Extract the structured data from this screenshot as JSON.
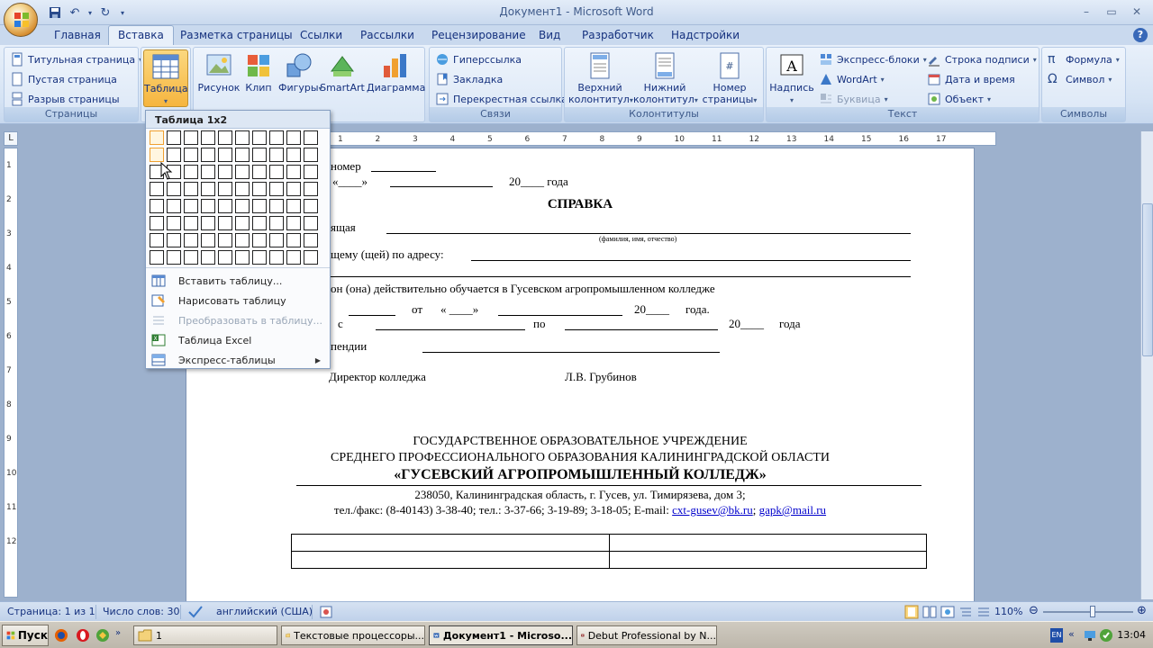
{
  "app": {
    "title": "Документ1 - Microsoft Word",
    "win_controls": [
      "–",
      "▭",
      "✕"
    ]
  },
  "tabs": [
    "Главная",
    "Вставка",
    "Разметка страницы",
    "Ссылки",
    "Рассылки",
    "Рецензирование",
    "Вид",
    "Разработчик",
    "Надстройки"
  ],
  "active_tab": "Вставка",
  "ribbon": {
    "pages": {
      "label": "Страницы",
      "items": [
        "Титульная страница",
        "Пустая страница",
        "Разрыв страницы"
      ]
    },
    "tables": {
      "label": "Таблица"
    },
    "illustrations": {
      "items": [
        "Рисунок",
        "Клип",
        "Фигуры",
        "SmartArt",
        "Диаграмма"
      ]
    },
    "links": {
      "label": "Связи",
      "items": [
        "Гиперссылка",
        "Закладка",
        "Перекрестная ссылка"
      ]
    },
    "header_footer": {
      "label": "Колонтитулы",
      "items": [
        {
          "line1": "Верхний",
          "line2": "колонтитул"
        },
        {
          "line1": "Нижний",
          "line2": "колонтитул"
        },
        {
          "line1": "Номер",
          "line2": "страницы"
        }
      ]
    },
    "text": {
      "label": "Текст",
      "big": "Надпись",
      "items": [
        "Экспресс-блоки",
        "WordArt",
        "Буквица"
      ],
      "items2": [
        "Строка подписи",
        "Дата и время",
        "Объект"
      ]
    },
    "symbols": {
      "label": "Символы",
      "items": [
        "Формула",
        "Символ"
      ]
    }
  },
  "table_menu": {
    "header": "Таблица 1x2",
    "grid_cols": 10,
    "grid_rows": 8,
    "selected_cols": 1,
    "selected_rows": 2,
    "items": [
      {
        "label": "Вставить таблицу...",
        "icon": "insert-table-icon",
        "disabled": false
      },
      {
        "label": "Нарисовать таблицу",
        "icon": "draw-table-icon",
        "disabled": false
      },
      {
        "label": "Преобразовать в таблицу...",
        "icon": "convert-table-icon",
        "disabled": true
      },
      {
        "label": "Таблица Excel",
        "icon": "excel-table-icon",
        "disabled": false
      },
      {
        "label": "Экспресс-таблицы",
        "icon": "quick-tables-icon",
        "disabled": false
      }
    ]
  },
  "ruler": {
    "h_ticks": [
      "1",
      "2",
      "3",
      "4",
      "5",
      "6",
      "7",
      "8",
      "9",
      "10",
      "11",
      "12",
      "13",
      "14",
      "15",
      "16",
      "17"
    ],
    "v_ticks": [
      "1",
      "2",
      "3",
      "4",
      "5",
      "6",
      "7",
      "8",
      "9",
      "10",
      "11",
      "12"
    ]
  },
  "document": {
    "l1": "номер",
    "l2a": "«____»",
    "l2b": "20____  года",
    "title": "СПРАВКА",
    "l3": "ящая",
    "l3note": "(фамилия, имя, отчество)",
    "l4": "щему (щей) по адресу:",
    "l5": "он (она)  действительно обучается  в  Гусевском  агропромышленном колледже",
    "l6a": "от",
    "l6b": "«  ____»",
    "l6c": "20____",
    "l6d": "года.",
    "l7a": "с",
    "l7b": "по",
    "l7c": "20____",
    "l7d": "года",
    "l8": "пендии",
    "director": "Директор  колледжа",
    "signature": "Л.В. Грубинов",
    "org1": "ГОСУДАРСТВЕННОЕ ОБРАЗОВАТЕЛЬНОЕ УЧРЕЖДЕНИЕ",
    "org2": "СРЕДНЕГО ПРОФЕССИОНАЛЬНОГО ОБРАЗОВАНИЯ КАЛИНИНГРАДСКОЙ ОБЛАСТИ",
    "org3": "«ГУСЕВСКИЙ АГРОПРОМЫШЛЕННЫЙ КОЛЛЕДЖ»",
    "address": "238050, Калининградская область, г. Гусев, ул. Тимирязева, дом 3;",
    "contacts": "тел./факс: (8-40143) 3-38-40; тел.: 3-37-66; 3-19-89; 3-18-05; E-mail:",
    "email1": "cxt-gusev@bk.ru",
    "sep": ";",
    "email2": "gapk@mail.ru"
  },
  "status": {
    "page": "Страница: 1 из 1",
    "words": "Число слов: 30",
    "lang": "английский (США)",
    "zoom": "110%",
    "zoom_fraction": 0.55
  },
  "taskbar": {
    "start": "Пуск",
    "items": [
      "1",
      "Текстовые процессоры...",
      "Документ1 - Microso...",
      "Debut Professional by N..."
    ],
    "active_index": 2,
    "lang": "EN",
    "clock": "13:04"
  },
  "colors": {
    "ribbon_bg": "#d5e3f4",
    "highlight": "#f6b53f",
    "link": "#0000cc"
  }
}
